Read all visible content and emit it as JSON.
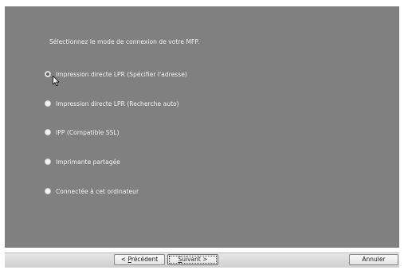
{
  "dialog": {
    "prompt": "Sélectionnez le mode de connexion de votre MFP.",
    "options": [
      {
        "label": "Impression directe LPR (Spécifier l'adresse)",
        "selected": true
      },
      {
        "label": "Impression directe LPR (Recherche auto)",
        "selected": false
      },
      {
        "label": "IPP (Compatible SSL)",
        "selected": false
      },
      {
        "label": "Imprimante partagée",
        "selected": false
      },
      {
        "label": "Connectée à cet ordinateur",
        "selected": false
      }
    ]
  },
  "buttons": {
    "back_prefix": "< ",
    "back_key": "P",
    "back_rest": "récédent",
    "next_key": "S",
    "next_rest": "uivant >",
    "cancel": "Annuler"
  },
  "colors": {
    "panel": "#808080",
    "text": "#f2f2f2"
  },
  "icons": {
    "cursor": "arrow-pointer"
  }
}
